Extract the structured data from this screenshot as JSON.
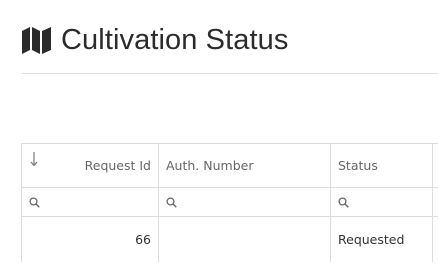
{
  "page": {
    "title": "Cultivation Status",
    "title_icon": "map-icon"
  },
  "grid": {
    "columns": [
      {
        "label": "Request Id",
        "sort_icon": "sort-descending-icon"
      },
      {
        "label": "Auth. Number"
      },
      {
        "label": "Status"
      }
    ],
    "filter_icon": "search-icon",
    "rows": [
      {
        "request_id": "66",
        "auth_number": "",
        "status": "Requested"
      }
    ]
  },
  "colors": {
    "border": "#dcdcdc",
    "header_text": "#666666",
    "title_text": "#2b2b2b"
  }
}
